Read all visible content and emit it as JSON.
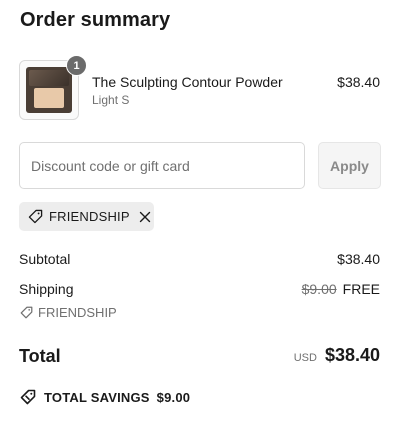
{
  "header": {
    "title": "Order summary"
  },
  "item": {
    "quantity": "1",
    "name": "The Sculpting Contour Powder",
    "variant": "Light S",
    "price": "$38.40"
  },
  "discount": {
    "placeholder": "Discount code or gift card",
    "value": "",
    "apply_label": "Apply",
    "applied_code": "FRIENDSHIP"
  },
  "summary": {
    "subtotal_label": "Subtotal",
    "subtotal_value": "$38.40",
    "shipping_label": "Shipping",
    "shipping_original": "$9.00",
    "shipping_value": "FREE",
    "shipping_code": "FRIENDSHIP",
    "total_label": "Total",
    "currency": "USD",
    "total_value": "$38.40",
    "savings_label": "TOTAL SAVINGS",
    "savings_value": "$9.00"
  },
  "icons": {
    "tag": "tag-icon",
    "remove": "close-icon",
    "savings": "discount-tag-icon"
  },
  "colors": {
    "text": "#1a1a1a",
    "muted": "#707070",
    "chip_bg": "#ededed",
    "badge_bg": "#6b6b6b"
  }
}
